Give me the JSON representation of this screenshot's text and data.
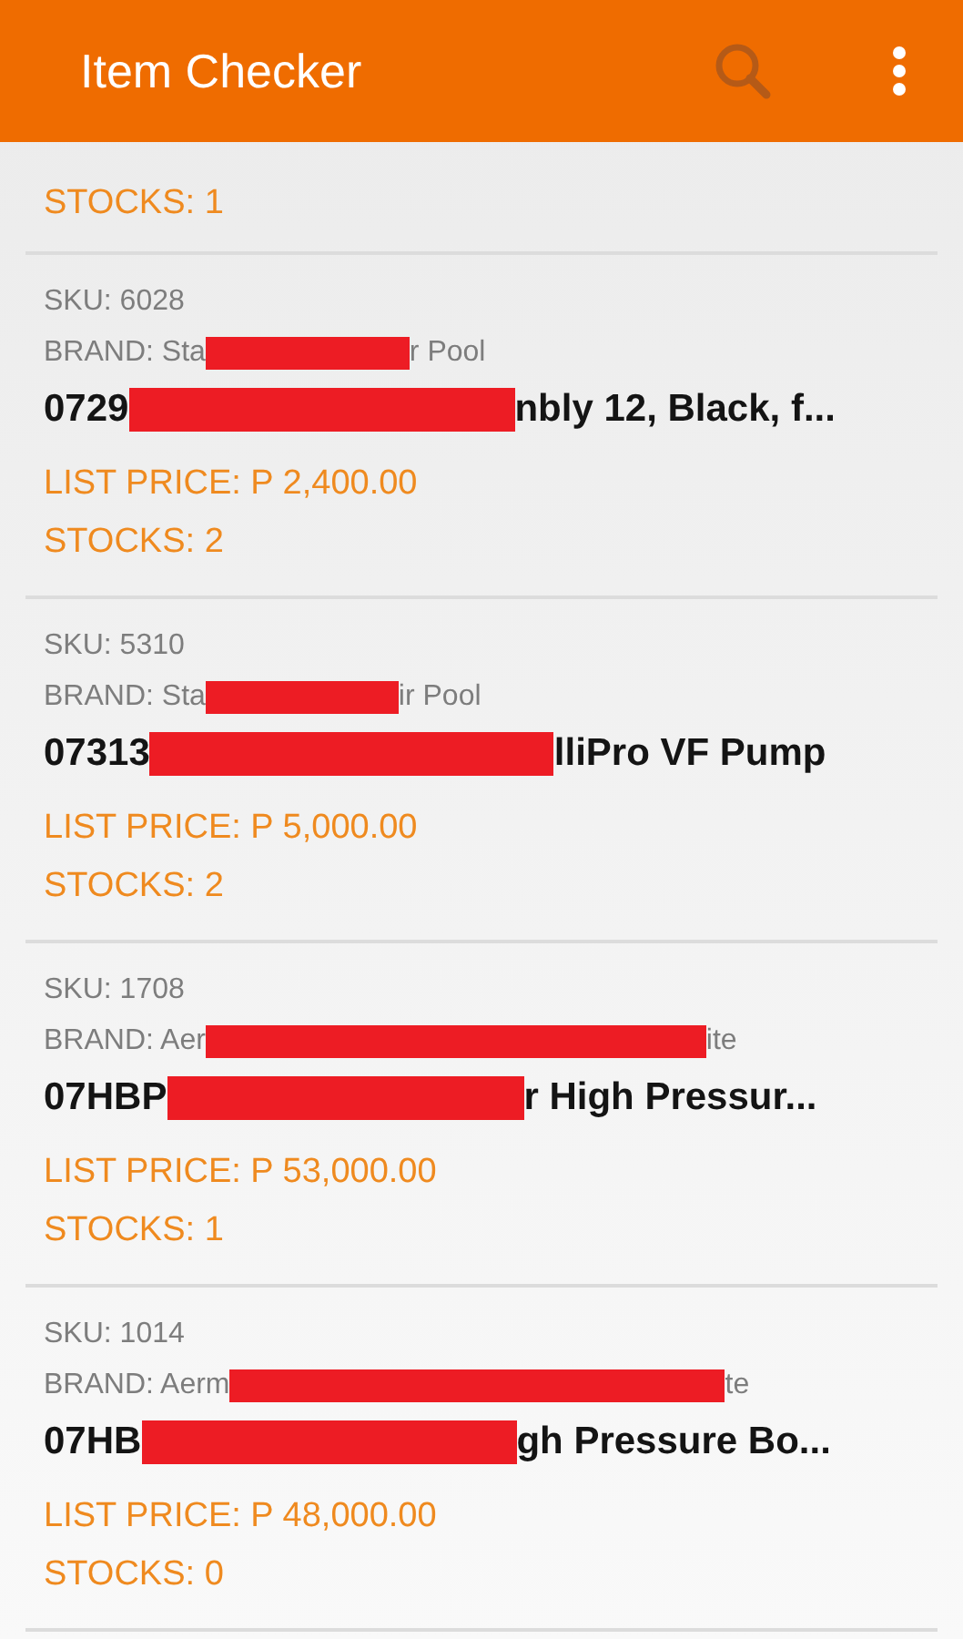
{
  "app_bar": {
    "title": "Item Checker"
  },
  "partial_item": {
    "stocks": "STOCKS: 1"
  },
  "items": [
    {
      "sku": "SKU: 6028",
      "brand": {
        "before": "BRAND: Sta",
        "after": "r Pool"
      },
      "name": {
        "before": "0729",
        "after": "nbly 12, Black, f..."
      },
      "price": "LIST PRICE: P 2,400.00",
      "stocks": "STOCKS: 2"
    },
    {
      "sku": "SKU: 5310",
      "brand": {
        "before": "BRAND: Sta",
        "after": "ir Pool"
      },
      "name": {
        "before": "07313",
        "after": "lliPro VF Pump"
      },
      "price": "LIST PRICE: P 5,000.00",
      "stocks": "STOCKS: 2"
    },
    {
      "sku": "SKU: 1708",
      "brand": {
        "before": "BRAND: Aer",
        "after": "ite"
      },
      "name": {
        "before": "07HBP",
        "after": "r High Pressur..."
      },
      "price": "LIST PRICE: P 53,000.00",
      "stocks": "STOCKS: 1"
    },
    {
      "sku": "SKU: 1014",
      "brand": {
        "before": "BRAND: Aerm",
        "after": "te"
      },
      "name": {
        "before": "07HB",
        "after": "gh Pressure Bo..."
      },
      "price": "LIST PRICE: P 48,000.00",
      "stocks": "STOCKS: 0"
    }
  ]
}
